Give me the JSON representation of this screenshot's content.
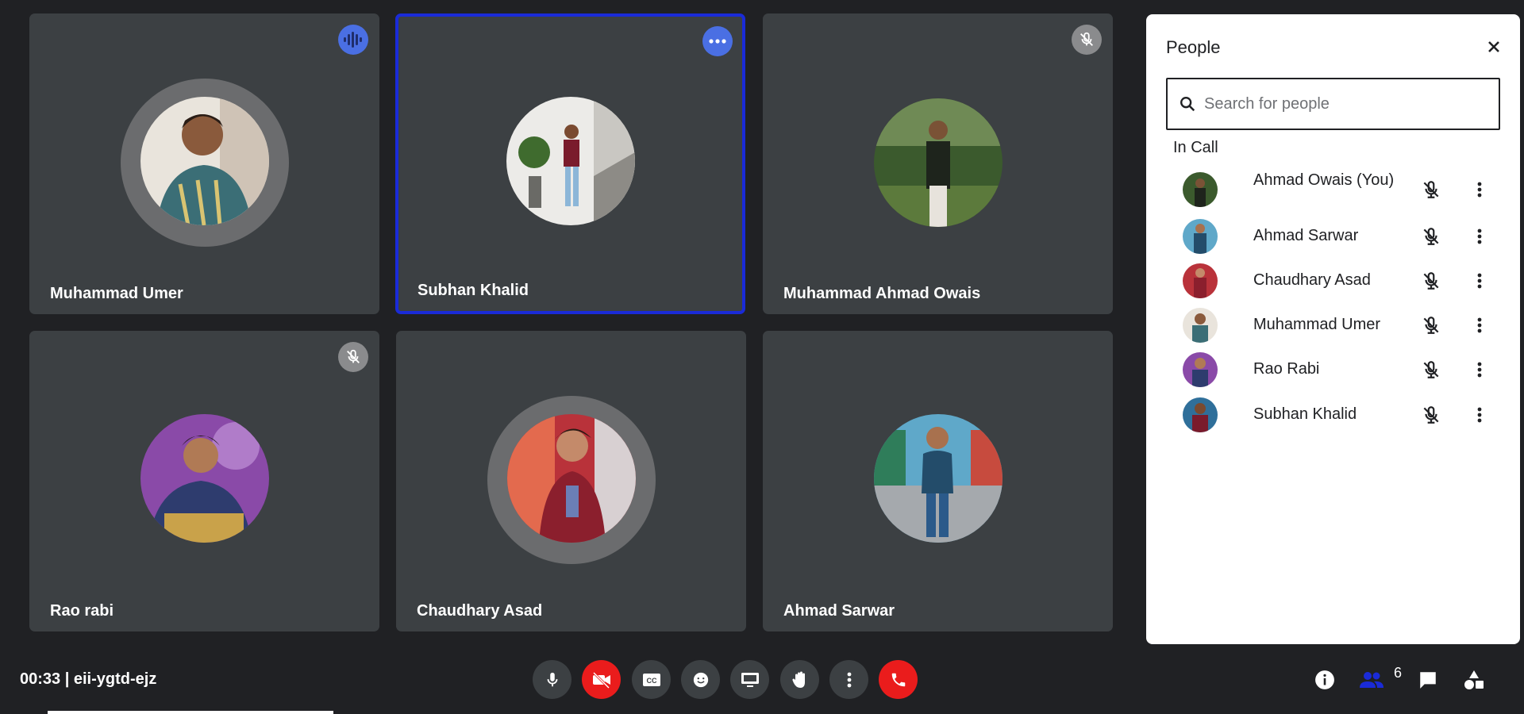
{
  "tiles": [
    {
      "name": "Muhammad Umer",
      "badge": "audio-wave-icon"
    },
    {
      "name": "Subhan Khalid",
      "badge": "more-horizontal-icon",
      "selected": true
    },
    {
      "name": "Muhammad Ahmad Owais",
      "badge": "mic-off-icon"
    },
    {
      "name": "Rao rabi",
      "badge": "mic-off-icon"
    },
    {
      "name": "Chaudhary Asad",
      "badge": "none"
    },
    {
      "name": "Ahmad Sarwar",
      "badge": "none"
    }
  ],
  "people_panel": {
    "title": "People",
    "search_placeholder": "Search for people",
    "section_label": "In Call",
    "participants": [
      {
        "name": "Ahmad Owais (You)"
      },
      {
        "name": "Ahmad Sarwar"
      },
      {
        "name": "Chaudhary Asad"
      },
      {
        "name": "Muhammad Umer"
      },
      {
        "name": "Rao Rabi"
      },
      {
        "name": "Subhan Khalid"
      }
    ]
  },
  "footer": {
    "meeting_info": "00:33 | eii-ygtd-ejz",
    "controls": [
      "mic-icon",
      "video-off-icon",
      "captions-icon",
      "emoji-icon",
      "present-screen-icon",
      "raise-hand-icon",
      "more-vert-icon",
      "end-call-icon"
    ],
    "right_icons": [
      "info-icon",
      "people-icon",
      "chat-icon",
      "activities-icon"
    ],
    "people_count": "6"
  },
  "colors": {
    "background": "#202124",
    "tile": "#3c4043",
    "selected_border": "#1a2bd8",
    "end_call_red": "#ea1c1c",
    "accent_blue": "#4a6fe3"
  }
}
